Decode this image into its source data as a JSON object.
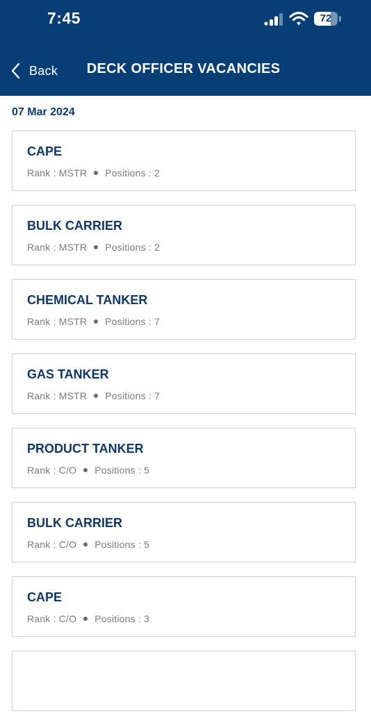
{
  "status_bar": {
    "time": "7:45",
    "battery_level": "72",
    "battery_percent": 72
  },
  "nav": {
    "back_label": "Back",
    "title": "DECK OFFICER VACANCIES"
  },
  "date": "07 Mar 2024",
  "vacancies": [
    {
      "vessel": "CAPE",
      "rank_label": "Rank : MSTR",
      "positions_label": "Positions : 2"
    },
    {
      "vessel": "BULK CARRIER",
      "rank_label": "Rank : MSTR",
      "positions_label": "Positions : 2"
    },
    {
      "vessel": "CHEMICAL TANKER",
      "rank_label": "Rank : MSTR",
      "positions_label": "Positions : 7"
    },
    {
      "vessel": "GAS TANKER",
      "rank_label": "Rank : MSTR",
      "positions_label": "Positions : 7"
    },
    {
      "vessel": "PRODUCT TANKER",
      "rank_label": "Rank : C/O",
      "positions_label": "Positions : 5"
    },
    {
      "vessel": "BULK CARRIER",
      "rank_label": "Rank : C/O",
      "positions_label": "Positions : 5"
    },
    {
      "vessel": "CAPE",
      "rank_label": "Rank : C/O",
      "positions_label": "Positions : 3"
    },
    {
      "vessel": "",
      "rank_label": "",
      "positions_label": ""
    }
  ],
  "colors": {
    "header_bg": "#073e75",
    "title_text": "#0d3768",
    "meta_text": "#7a7a7a",
    "card_border": "#d0d0d0"
  },
  "icons": {
    "back": "chevron-left-icon",
    "signal": "cellular-signal-icon",
    "wifi": "wifi-icon",
    "battery": "battery-icon"
  }
}
